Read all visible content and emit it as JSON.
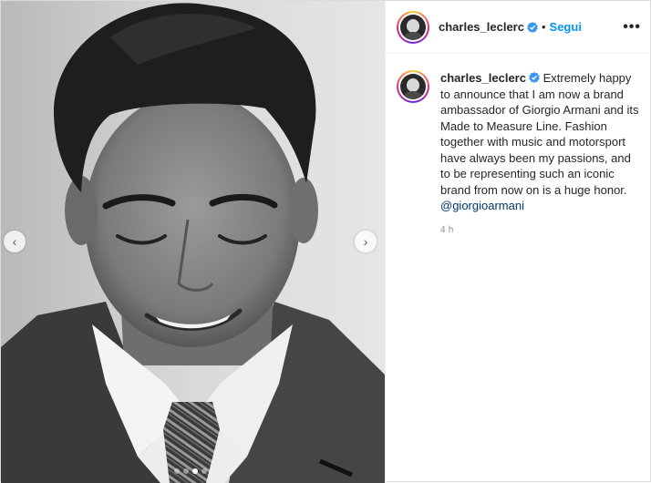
{
  "post": {
    "username": "charles_leclerc",
    "verified": true,
    "separator": "•",
    "follow_label": "Segui",
    "more_label": "•••",
    "caption_text": "Extremely happy to announce that I am now a brand ambassador of Giorgio Armani and its Made to Measure Line. Fashion together with music and motorsport have always been my passions, and to be representing such an iconic brand from now on is a huge honor.",
    "caption_mention": "@giorgioarmani",
    "timestamp": "4 h"
  },
  "carousel": {
    "prev_icon": "chevron-left-icon",
    "next_icon": "chevron-right-icon",
    "slide_count": 4,
    "active_index": 2
  },
  "colors": {
    "follow": "#0095f6",
    "verified": "#3897f0",
    "mention": "#00376b",
    "timestamp": "#8e8e8e"
  }
}
